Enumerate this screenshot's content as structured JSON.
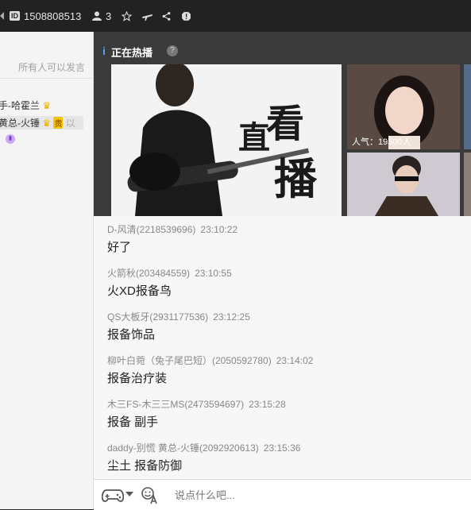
{
  "topbar": {
    "id_badge": "ID",
    "room_id": "1508808513",
    "user_count": "3",
    "icons": [
      "person-icon",
      "star-icon",
      "plane-icon",
      "share-icon",
      "report-icon"
    ]
  },
  "left": {
    "permission_text": "所有人可以发言",
    "members": [
      {
        "text": "手-哈霍兰"
      },
      {
        "text": "黄总-火锤",
        "badge": "贵",
        "tail": "以"
      },
      {
        "text": ""
      }
    ]
  },
  "hot": {
    "title": "正在热播",
    "help": "?",
    "banner_text_1": "直",
    "banner_text_2": "看",
    "banner_text_3": "播",
    "popularity": "人气：19500人"
  },
  "chat": {
    "messages": [
      {
        "user": "D-风清(2218539696)",
        "time": "23:10:22",
        "text": "好了"
      },
      {
        "user": "火箭秋(203484559)",
        "time": "23:10:55",
        "text": "火XD报备鸟"
      },
      {
        "user": "QS大板牙(2931177536)",
        "time": "23:12:25",
        "text": "报备饰品"
      },
      {
        "user": "柳叶白菀（兔子尾巴短）(2050592780)",
        "time": "23:14:02",
        "text": "报备治疗装"
      },
      {
        "user": "木三FS-木三三MS(2473594697)",
        "time": "23:15:28",
        "text": "报备 副手"
      },
      {
        "user": "daddy-别慌 黄总-火锤(2092920613)",
        "time": "23:15:36",
        "text": "尘土 报备防御"
      }
    ]
  },
  "input": {
    "placeholder": "说点什么吧..."
  },
  "colors": {
    "topbar_bg": "#222222",
    "hot_panel_bg": "#3a3a3a",
    "chat_bg": "#f7f7f7",
    "accent": "#4aa8ff"
  }
}
